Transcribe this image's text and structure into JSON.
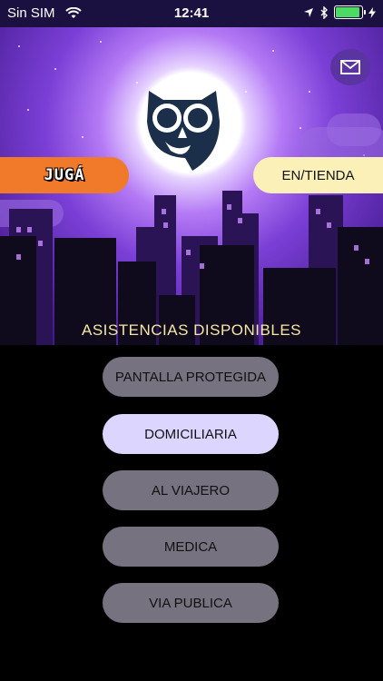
{
  "status_bar": {
    "carrier": "Sin SIM",
    "time": "12:41"
  },
  "actions": {
    "play_label": "JUGÁ",
    "store_label": "EN/TIENDA"
  },
  "assistances": {
    "title": "ASISTENCIAS DISPONIBLES",
    "options": [
      {
        "label": "PANTALLA PROTEGIDA",
        "active": false
      },
      {
        "label": "DOMICILIARIA",
        "active": true
      },
      {
        "label": "AL VIAJERO",
        "active": false
      },
      {
        "label": "MEDICA",
        "active": false
      },
      {
        "label": "VIA PUBLICA",
        "active": false
      }
    ]
  },
  "colors": {
    "play_button": "#f07a2a",
    "store_button": "#fbf1b8",
    "title_text": "#f5e7a4",
    "option_default": "#77727f",
    "option_active": "#dcd6ff",
    "owl": "#1b2f4a"
  },
  "icons": [
    "wifi-icon",
    "location-arrow-icon",
    "bluetooth-icon",
    "battery-icon",
    "mail-icon",
    "owl-logo-icon"
  ]
}
